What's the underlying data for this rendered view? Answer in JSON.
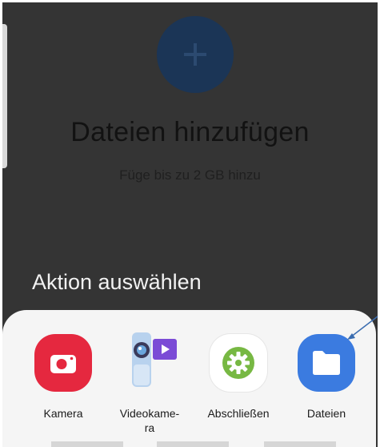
{
  "header": {
    "title": "Dateien hinzufügen",
    "subtitle": "Füge bis zu 2 GB hinzu",
    "add_icon": "plus-icon"
  },
  "section": {
    "title": "Aktion auswählen"
  },
  "apps": [
    {
      "label": "Kamera",
      "icon": "camera-icon",
      "color": "#e5283f"
    },
    {
      "label": "Videokame-\nra",
      "icon": "video-camera-icon",
      "color": "#7b4bd6"
    },
    {
      "label": "Abschließen",
      "icon": "gear-icon",
      "color": "#77b843"
    },
    {
      "label": "Dateien",
      "icon": "folder-icon",
      "color": "#3b7be0"
    }
  ],
  "colors": {
    "dim_background": "#343434",
    "sheet": "#f5f5f5",
    "add_button": "#1b3556",
    "annotation_arrow": "#3b6db0"
  }
}
